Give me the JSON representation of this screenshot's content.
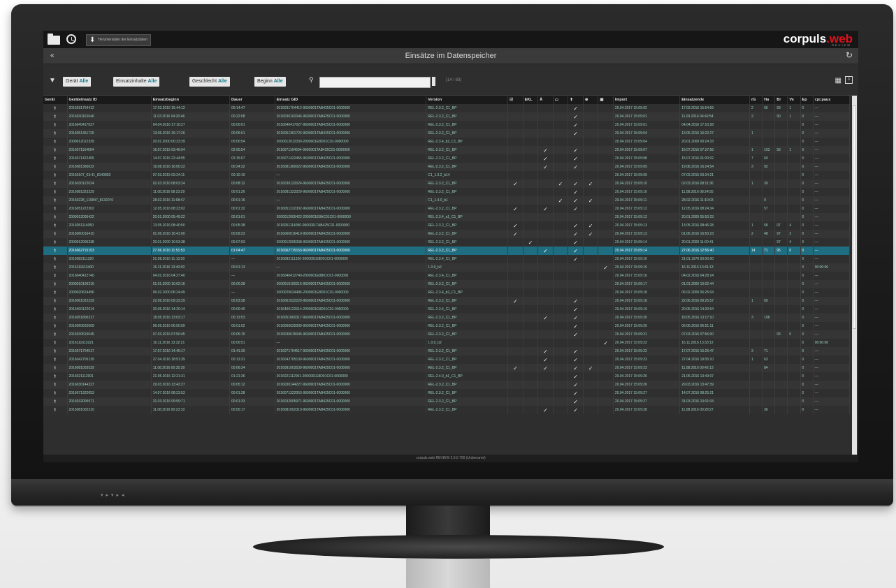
{
  "app": {
    "logo_main": "corpuls",
    "logo_web": ".web",
    "logo_sub": "REVIEW",
    "download_label": "Herunterladen der Einsatzdaten",
    "page_title": "Einsätze im Datenspeicher",
    "result_count": "(14 / 83)",
    "footer": "corpuls.web REVIEW 2.0.0.700 (Unbenannt)"
  },
  "filters": [
    {
      "label": "Gerät",
      "value": "Alle"
    },
    {
      "label": "Einsatzinhalte",
      "value": "Alle"
    },
    {
      "label": "Geschlecht",
      "value": "Alle"
    },
    {
      "label": "Beginn",
      "value": "Alle"
    }
  ],
  "search": {
    "placeholder": ""
  },
  "table": {
    "columns": [
      "Gerät",
      "Geräteinsatz ID",
      "Einsatzbeginn",
      "Dauer",
      "Einsatz GID",
      "Version",
      "☑",
      "EKL",
      "Ä",
      "▭",
      "⬆",
      "⊕",
      "▣",
      "Import",
      "Einsatzende",
      "rG",
      "Ha",
      "Br",
      "Ve",
      "Ep",
      "cpr.paus"
    ],
    "rows": [
      [
        "2016031704412",
        "17.03.2016 15:44:12",
        "00:14:47",
        "2016031704412-9600001TAB425C01-0000000",
        "REL-2.3.2_C1_BP",
        "",
        "",
        "",
        "",
        "✓",
        "",
        "",
        "20.04.2017 15:09:02",
        "17.03.2016 15:54:59",
        "2",
        "65",
        "93",
        "1",
        "0",
        "—"
      ],
      [
        "2016030162046",
        "11.03.2016 04:20:46",
        "00:22:08",
        "2016030162046-9600001TAB425C01-0000000",
        "REL-2.3.2_C1_BP",
        "",
        "",
        "",
        "",
        "✓",
        "",
        "",
        "20.04.2017 15:09:01",
        "11.03.2016 04:42:54",
        "2",
        "",
        "90",
        "1",
        "0",
        "—"
      ],
      [
        "2016040417027",
        "04.04.2016 17:10:27",
        "00:00:01",
        "2016040417027-9600001TAB425C01-0000000",
        "REL-2.3.2_C1_BP",
        "",
        "",
        "",
        "",
        "✓",
        "",
        "",
        "20.04.2017 15:09:01",
        "04.04.2016 17:10:28",
        "",
        "",
        "",
        "",
        "0",
        "—"
      ],
      [
        "2016051361726",
        "13.05.2016 16:17:26",
        "00:05:01",
        "2016051361726-9600001TAB425C01-0000000",
        "REL-2.3.2_C1_BP",
        "",
        "",
        "",
        "",
        "✓",
        "",
        "",
        "20.04.2017 15:09:04",
        "13.05.2016 16:22:27",
        "1",
        "",
        "",
        "",
        "0",
        "—"
      ],
      [
        "2000012012339",
        "20.01.2000 00:23:39",
        "00:00:54",
        "2000012012339-2000001E8D01C01-0000000",
        "REL-2.3.4_b2_C1_BP",
        "",
        "",
        "",
        "",
        "",
        "",
        "",
        "20.04.2017 15:09:04",
        "20.01.2000 00:24:33",
        "",
        "",
        "",
        "",
        "0",
        "—"
      ],
      [
        "2016071164604",
        "16.07.2016 03:46:04",
        "02:00:54",
        "2016071164604-9600001TAB425C01-0000000",
        "REL-2.3.2_C1_BP",
        "",
        "",
        "✓",
        "",
        "✓",
        "",
        "",
        "20.04.2017 15:09:07",
        "16.07.2016 07:37:58",
        "1",
        "103",
        "93",
        "1",
        "0",
        "—"
      ],
      [
        "2016071422455",
        "14.07.2016 22:44:55",
        "02:15:07",
        "2016071422455-9600001TAB425C01-0000000",
        "REL-2.3.2_C1_BP",
        "",
        "",
        "✓",
        "",
        "✓",
        "",
        "",
        "20.04.2017 15:09:08",
        "15.07.2016 01:00:02",
        "7",
        "60",
        "",
        "",
        "0",
        "—"
      ],
      [
        "2016081360022",
        "19.08.2016 16:00:22",
        "00:24:32",
        "2016081360022-9600001TAB425C01-0000000",
        "REL-2.3.2_C1_BP",
        "",
        "",
        "✓",
        "",
        "✓",
        "",
        "",
        "20.04.2017 15:09:09",
        "19.08.2016 16:24:54",
        "3",
        "92",
        "",
        "",
        "0",
        "—"
      ],
      [
        "20150107_03:41_8140893",
        "07.03.2015 03:24:11",
        "00:10:10",
        "—",
        "C1_1.3.2_b14",
        "",
        "",
        "",
        "",
        "",
        "",
        "",
        "20.04.2017 15:09:09",
        "07.03.2015 03:34:21",
        "",
        "",
        "",
        "",
        "0",
        "—"
      ],
      [
        "2016030122024",
        "02.03.2016 08:03:24",
        "00:08:12",
        "2016030122024-9600001TAB425C01-0000000",
        "REL-2.3.2_C1_BP",
        "✓",
        "",
        "",
        "✓",
        "✓",
        "✓",
        "",
        "20.04.2017 15:09:10",
        "02.03.2016 08:11:36",
        "1",
        "39",
        "",
        "",
        "0",
        "—"
      ],
      [
        "2016081323229",
        "11.08.2016 08:23:29",
        "00:01:26",
        "2016081323229-9600001TAB425C01-0000000",
        "REL-2.3.2_C1_BP",
        "",
        "",
        "",
        "",
        "✓",
        "",
        "",
        "20.04.2017 15:09:10",
        "11.08.2016 08:24:55",
        "",
        "",
        "",
        "",
        "0",
        "—"
      ],
      [
        "20160228_110847_8132070",
        "28.02.2016 11:08:47",
        "00:01:16",
        "—",
        "C1_1.4.0_b1",
        "",
        "",
        "",
        "✓",
        "✓",
        "✓",
        "",
        "20.04.2017 15:09:11",
        "28.02.2016 11:10:03",
        "",
        "0",
        "",
        "",
        "0",
        "—"
      ],
      [
        "2016051222302",
        "12.05.2016 08:23:02",
        "00:01:32",
        "2016051222302-9600001TAB425C01-0000000",
        "REL-2.3.2_C1_BP",
        "✓",
        "",
        "✓",
        "",
        "✓",
        "",
        "",
        "20.04.2017 15:09:12",
        "12.05.2016 08:24:34",
        "",
        "57",
        "",
        "",
        "0",
        "—"
      ],
      [
        "2000012005422",
        "20.01.2000 05:49:22",
        "00:01:01",
        "2000012005422-2000001E8AC01C01-0000000",
        "REL-2.3.4_a1_C1_BP",
        "",
        "",
        "",
        "",
        "",
        "",
        "",
        "20.04.2017 15:09:12",
        "20.01.2000 05:50:23",
        "",
        "",
        "",
        "",
        "0",
        "—"
      ],
      [
        "2016051114050",
        "13.05.2016 08:40:50",
        "00:05:38",
        "2016051114050-9600001TAB425C01-0000000",
        "REL-2.3.2_C1_BP",
        "✓",
        "",
        "",
        "",
        "✓",
        "✓",
        "",
        "20.04.2017 15:09:13",
        "13.05.2016 08:46:28",
        "1",
        "58",
        "97",
        "4",
        "0",
        "—"
      ],
      [
        "2016060016410",
        "01.06.2016 16:41:00",
        "00:09:23",
        "2016060016410-9600001TAB425C01-0000000",
        "REL-2.3.2_C1_BP",
        "✓",
        "",
        "",
        "",
        "✓",
        "✓",
        "",
        "20.04.2017 15:09:13",
        "01.06.2016 16:50:23",
        "2",
        "48",
        "97",
        "2",
        "0",
        "—"
      ],
      [
        "2000012005338",
        "20.01.2000 10:53:38",
        "00:07:03",
        "2000012005338-9600001TAB425C01-0000000",
        "REL-2.3.2_C1_BP",
        "",
        "✓",
        "",
        "",
        "✓",
        "",
        "",
        "20.04.2017 15:09:14",
        "20.01.2000 11:00:41",
        "",
        "",
        "97",
        "4",
        "0",
        "—"
      ],
      [
        "2016062715153",
        "27.06.2016 11:51:53",
        "01:04:47",
        "2016062715153-9600001TAB425C01-0000000",
        "REL-2.3.2_C1_BP",
        "",
        "",
        "✓",
        "",
        "✓",
        "",
        "",
        "20.04.2017 15:09:14",
        "27.06.2016 12:56:40",
        "14",
        "71",
        "95",
        "0",
        "0",
        "—"
      ],
      [
        "2016082111320",
        "21.08.2016 11:13:20",
        "—",
        "2016082111320-2000001E8D01C01-0000000",
        "REL-2.3.4_C1_BP",
        "",
        "",
        "",
        "",
        "✓",
        "",
        "",
        "20.04.2017 15:09:16",
        "21.01.1970 00:00:00",
        "",
        "",
        "",
        "",
        "0",
        "—"
      ],
      [
        "2016111613400",
        "16.11.2016 13:40:00",
        "00:01:13",
        "—",
        "1.0.0_b2",
        "",
        "",
        "",
        "",
        "",
        "",
        "✓",
        "20.04.2017 15:09:16",
        "16.11.2016 13:41:13",
        "",
        "",
        "",
        "",
        "0",
        "00:00:00"
      ],
      [
        "2016040412740",
        "04.02.2016 04:27:40",
        "—",
        "2016040412740-2000001E8B01C01-0000000",
        "REL-2.3.4_C1_BP",
        "",
        "",
        "",
        "",
        "",
        "",
        "",
        "20.04.2017 15:09:16",
        "04.02.2016 04:28:24",
        "",
        "",
        "",
        "",
        "0",
        "—"
      ],
      [
        "2000010100216",
        "01.01.2000 10:02:16",
        "00:00:28",
        "2000010100216-9600001TAB425C01-0000000",
        "REL-2.3.2_C1_BP",
        "",
        "",
        "",
        "",
        "",
        "",
        "",
        "20.04.2017 15:09:17",
        "01.01.2000 10:02:44",
        "",
        "",
        "",
        "",
        "0",
        "—"
      ],
      [
        "2000020624496",
        "06.02.2000 06:24:49",
        "—",
        "2000020624496-2000001E8D01C01-0000000",
        "REL-2.3.4_b2_C1_BP",
        "",
        "",
        "",
        "",
        "",
        "",
        "",
        "20.04.2017 15:09:18",
        "06.02.2000 06:25:04",
        "",
        "",
        "",
        "",
        "0",
        "—"
      ],
      [
        "2016061022229",
        "22.06.2016 09:22:29",
        "00:03:28",
        "2016061022229-9600001TAB425C01-0000000",
        "REL-2.3.2_C1_BP",
        "✓",
        "",
        "",
        "",
        "✓",
        "",
        "",
        "20.04.2017 15:09:18",
        "22.06.2016 09:25:57",
        "1",
        "60",
        "",
        "",
        "0",
        "—"
      ],
      [
        "2016400122014",
        "20.05.2016 14:20:14",
        "00:00:40",
        "2016400122014-2000001E8D01C01-0000000",
        "REL-2.3.4_C1_BP",
        "",
        "",
        "",
        "",
        "✓",
        "",
        "",
        "20.04.2017 15:09:19",
        "20.05.2016 14:20:54",
        "",
        "",
        "",
        "",
        "0",
        "—"
      ],
      [
        "2016051800317",
        "18.05.2016 13:03:17",
        "00:13:53",
        "2016051800317-9600001TAB425C01-0000000",
        "REL-2.3.2_C1_BP",
        "",
        "",
        "✓",
        "",
        "✓",
        "",
        "",
        "20.04.2017 15:09:20",
        "18.05.2016 13:17:10",
        "3",
        "108",
        "",
        "",
        "0",
        "—"
      ],
      [
        "2016060625009",
        "06.06.2016 06:50:09",
        "00:01:02",
        "2016060625009-9600001TAB425C01-0000000",
        "REL-2.3.2_C1_BP",
        "",
        "",
        "",
        "",
        "✓",
        "",
        "",
        "20.04.2017 15:09:20",
        "06.06.2016 06:51:11",
        "",
        "",
        "",
        "",
        "0",
        "—"
      ],
      [
        "2016030615045",
        "07.03.2016 07:50:45",
        "00:05:15",
        "2016030615045-9600001TAB425C01-0000000",
        "REL-2.3.2_C1_BP",
        "",
        "",
        "",
        "",
        "✓",
        "",
        "",
        "20.04.2017 15:09:21",
        "07.03.2016 07:56:00",
        "",
        "",
        "93",
        "0",
        "0",
        "—"
      ],
      [
        "2016111613221",
        "16.11.2016 13:32:21",
        "00:00:51",
        "—",
        "1.0.0_b2",
        "",
        "",
        "",
        "",
        "",
        "",
        "✓",
        "20.04.2017 15:09:22",
        "16.11.2016 13:33:12",
        "",
        "",
        "",
        "",
        "0",
        "00:00:00"
      ],
      [
        "2016071704517",
        "17.07.2016 14:45:17",
        "01:41:30",
        "2016071704517-9600001TAB425C01-0000000",
        "REL-2.3.2_C1_BP",
        "",
        "",
        "✓",
        "",
        "✓",
        "",
        "",
        "20.04.2017 15:09:22",
        "17.07.2016 16:26:47",
        "3",
        "71",
        "",
        "",
        "0",
        "—"
      ],
      [
        "2016042705139",
        "27.04.2016 18:51:39",
        "00:13:31",
        "2016042705139-9600001TAB425C01-0000000",
        "REL-2.3.2_C1_BP",
        "",
        "",
        "✓",
        "",
        "✓",
        "",
        "",
        "20.04.2017 15:09:23",
        "27.04.2016 19:05:10",
        "1",
        "63",
        "",
        "",
        "0",
        "—"
      ],
      [
        "2016081003539",
        "11.08.2016 00:35:39",
        "00:06:34",
        "2016081003539-9600001TAB425C01-0000000",
        "REL-2.3.2_C1_BP",
        "✓",
        "",
        "✓",
        "",
        "✓",
        "✓",
        "",
        "20.04.2017 15:09:23",
        "11.08.2016 00:42:13",
        "",
        "84",
        "",
        "",
        "0",
        "—"
      ],
      [
        "2016021112001",
        "21.05.2016 12:21:31",
        "01:21:36",
        "2016021112001-2000001E8D01C01-0000000",
        "REL-2.4.0_b1_C1_BP",
        "",
        "",
        "",
        "",
        "✓",
        "",
        "",
        "20.04.2017 15:09:26",
        "21.05.2016 13:43:07",
        "",
        "",
        "",
        "",
        "0",
        "—"
      ],
      [
        "2016030144227",
        "29.03.2016 13:42:27",
        "00:05:12",
        "2016030144227-9600001TAB425C01-0000000",
        "REL-2.3.2_C1_BP",
        "",
        "",
        "",
        "",
        "✓",
        "",
        "",
        "20.04.2017 15:09:26",
        "29.03.2016 13:47:39",
        "",
        "",
        "",
        "",
        "0",
        "—"
      ],
      [
        "2016071322053",
        "14.07.2016 08:23:53",
        "00:01:28",
        "2016071322053-9600001TAB425C01-0000000",
        "REL-2.3.2_C1_BP",
        "",
        "",
        "",
        "",
        "✓",
        "",
        "",
        "20.04.2017 15:09:27",
        "14.07.2016 08:25:21",
        "",
        "",
        "",
        "",
        "0",
        "—"
      ],
      [
        "2016032005971",
        "31.03.2016 09:59:71",
        "00:01:33",
        "2016032005971-9600001TAB425C01-0000000",
        "REL-2.3.2_C1_BP",
        "",
        "",
        "",
        "",
        "✓",
        "",
        "",
        "20.04.2017 15:09:27",
        "31.03.2016 10:01:04",
        "",
        "",
        "",
        "",
        "0",
        "—"
      ],
      [
        "2016081002310",
        "11.08.2016 00:23:10",
        "00:05:17",
        "2016081002310-9600001TAB425C01-0000000",
        "REL-2.3.2_C1_BP",
        "",
        "",
        "✓",
        "",
        "✓",
        "",
        "",
        "20.04.2017 15:09:28",
        "11.08.2016 00:28:27",
        "",
        "36",
        "",
        "",
        "0",
        "—"
      ]
    ],
    "selected_index": 17
  }
}
